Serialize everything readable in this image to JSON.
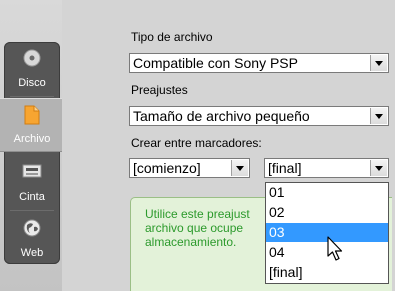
{
  "sidebar": {
    "tabs": [
      {
        "label": "Disco",
        "icon": "disc-icon"
      },
      {
        "label": "Archivo",
        "icon": "file-icon",
        "active": true
      },
      {
        "label": "Cinta",
        "icon": "tape-icon"
      },
      {
        "label": "Web",
        "icon": "globe-icon"
      }
    ]
  },
  "form": {
    "file_type_label": "Tipo de archivo",
    "file_type_value": "Compatible con Sony PSP",
    "preset_label": "Preajustes",
    "preset_value": "Tamaño de archivo pequeño",
    "markers_label": "Crear entre marcadores:",
    "start_value": "[comienzo]",
    "end_value": "[final]"
  },
  "info": {
    "line1": "Utilice este preajust",
    "line2": "archivo que ocupe",
    "line3": "almacenamiento."
  },
  "dropdown": {
    "options": [
      "01",
      "02",
      "03",
      "04",
      "[final]"
    ],
    "selected": "03"
  },
  "colors": {
    "accent": "#3399ff",
    "info_text": "#2c9a2c",
    "info_bg": "#e3f2d9"
  }
}
